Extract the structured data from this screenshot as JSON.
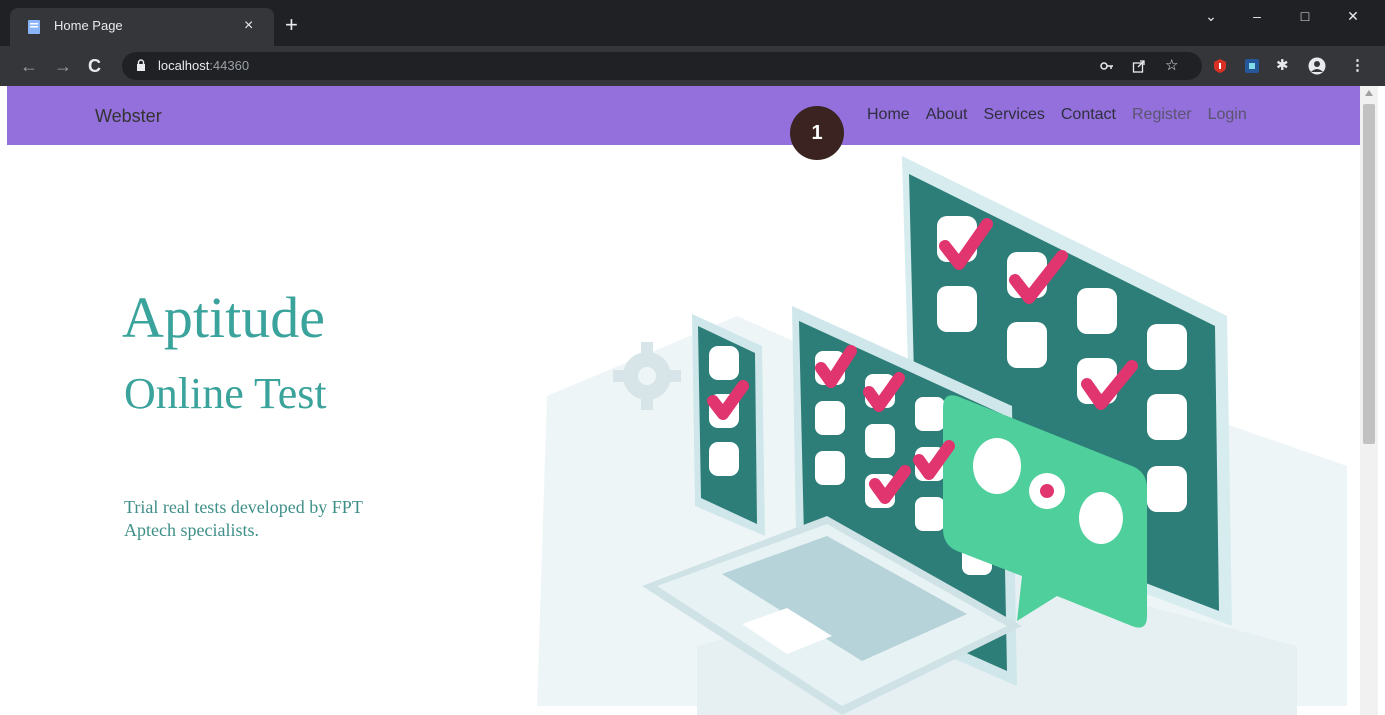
{
  "browser": {
    "tab_title": "Home Page",
    "tab_close": "×",
    "new_tab": "+",
    "url_host": "localhost",
    "url_port": ":44360",
    "window_buttons": [
      "⌄",
      "–",
      "□",
      "✕"
    ]
  },
  "navbar": {
    "brand": "Webster",
    "links": [
      "Home",
      "About",
      "Services",
      "Contact",
      "Register",
      "Login"
    ],
    "color": "#9370db"
  },
  "annotation": {
    "badge": "1"
  },
  "hero": {
    "title": "Aptitude",
    "subtitle": "Online Test",
    "description": "Trial real tests developed by FPT Aptech specialists.",
    "accent": "#3aa39b"
  },
  "icons": [
    "page-icon",
    "back-arrow-icon",
    "forward-arrow-icon",
    "reload-icon",
    "lock-icon",
    "key-icon",
    "share-icon",
    "star-icon",
    "extension-red-icon",
    "extension-grid-icon",
    "puzzle-icon",
    "profile-icon",
    "menu-dots-icon"
  ]
}
